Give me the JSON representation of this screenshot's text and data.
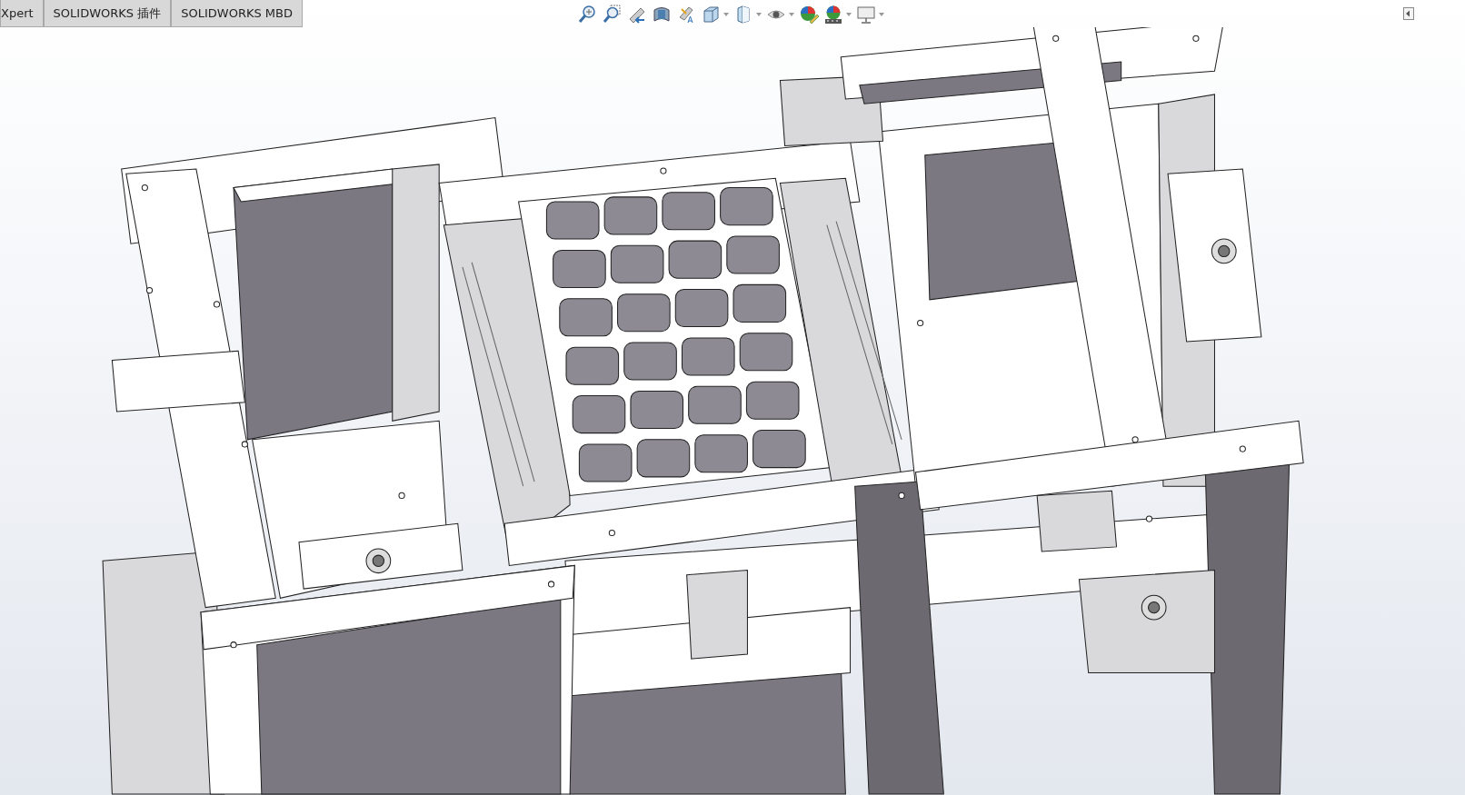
{
  "tabs": [
    {
      "label": "Xpert",
      "selected": false
    },
    {
      "label": "SOLIDWORKS 插件",
      "selected": false
    },
    {
      "label": "SOLIDWORKS MBD",
      "selected": false
    }
  ],
  "view_toolbar": [
    {
      "kind": "zoom-fit",
      "dropdown": false
    },
    {
      "kind": "zoom-area",
      "dropdown": false
    },
    {
      "kind": "previous-view",
      "dropdown": false
    },
    {
      "kind": "section-view",
      "dropdown": false
    },
    {
      "kind": "annotation-view",
      "dropdown": false
    },
    {
      "kind": "view-orientation",
      "dropdown": true
    },
    {
      "kind": "display-style",
      "dropdown": true
    },
    {
      "kind": "hide-show",
      "dropdown": true
    },
    {
      "kind": "edit-appearance",
      "dropdown": false
    },
    {
      "kind": "apply-scene",
      "dropdown": true
    },
    {
      "kind": "view-settings",
      "dropdown": true
    }
  ]
}
